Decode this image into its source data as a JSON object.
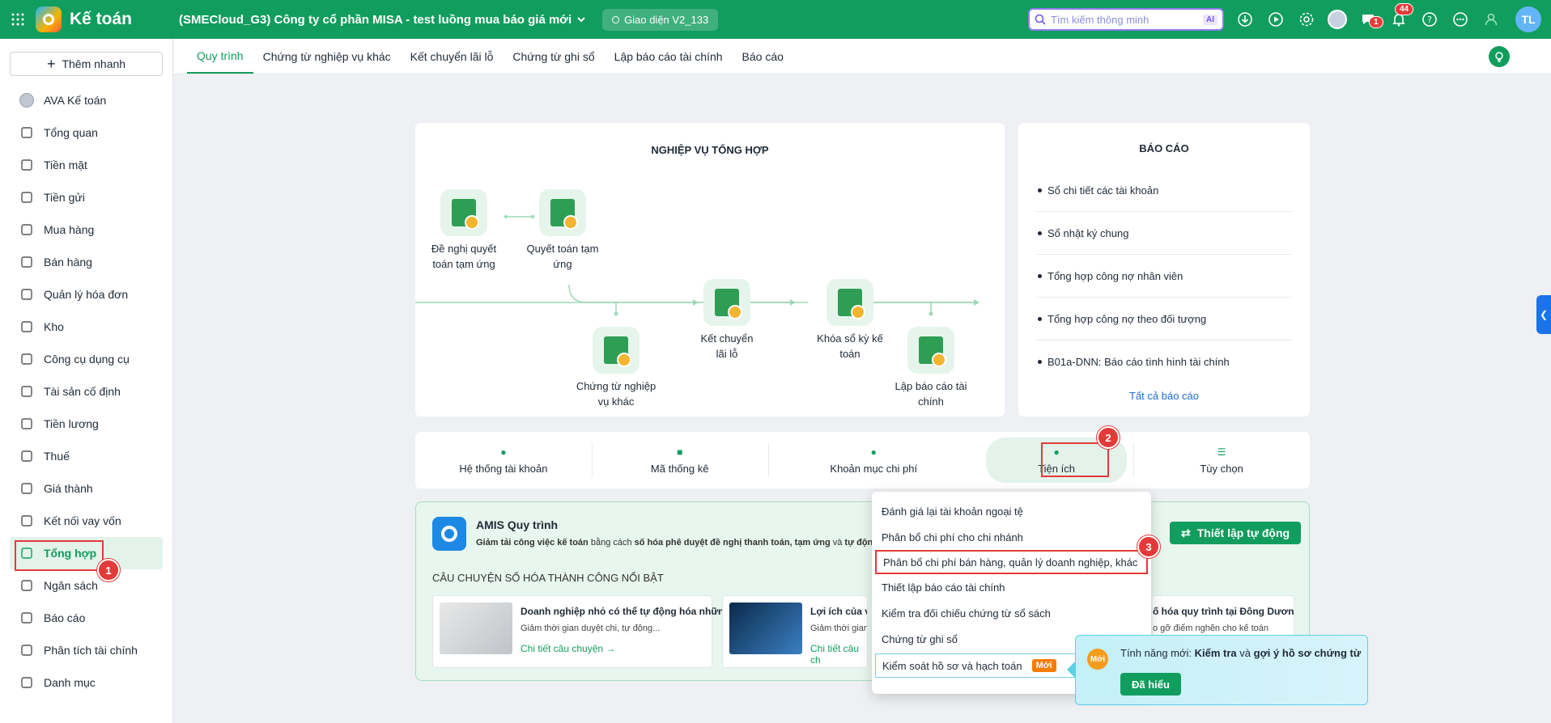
{
  "topbar": {
    "app_title": "Kế toán",
    "company": "(SMECloud_G3) Công ty cổ phần MISA - test luồng mua báo giá mới",
    "version": "Giao diện V2_133",
    "search_placeholder": "Tìm kiếm thông minh",
    "ai_label": "AI",
    "chat_badge": "1",
    "notif_badge": "44",
    "user_initials": "TL"
  },
  "sidebar": {
    "quick_add": "Thêm nhanh",
    "items": [
      {
        "label": "AVA Kế toán",
        "icon": "ava-avatar-icon"
      },
      {
        "label": "Tổng quan",
        "icon": "dashboard-icon"
      },
      {
        "label": "Tiền mặt",
        "icon": "cash-icon"
      },
      {
        "label": "Tiền gửi",
        "icon": "bank-icon"
      },
      {
        "label": "Mua hàng",
        "icon": "shopping-bag-icon"
      },
      {
        "label": "Bán hàng",
        "icon": "cart-icon"
      },
      {
        "label": "Quản lý hóa đơn",
        "icon": "invoice-icon"
      },
      {
        "label": "Kho",
        "icon": "warehouse-icon"
      },
      {
        "label": "Công cụ dụng cụ",
        "icon": "tools-icon"
      },
      {
        "label": "Tài sản cố định",
        "icon": "truck-icon"
      },
      {
        "label": "Tiền lương",
        "icon": "salary-icon"
      },
      {
        "label": "Thuế",
        "icon": "tax-icon"
      },
      {
        "label": "Giá thành",
        "icon": "price-tag-icon"
      },
      {
        "label": "Kết nối vay vốn",
        "icon": "loan-icon"
      },
      {
        "label": "Tổng hợp",
        "icon": "summary-icon"
      },
      {
        "label": "Ngân sách",
        "icon": "budget-icon"
      },
      {
        "label": "Báo cáo",
        "icon": "report-icon"
      },
      {
        "label": "Phân tích tài chính",
        "icon": "analysis-icon"
      },
      {
        "label": "Danh mục",
        "icon": "list-icon"
      }
    ]
  },
  "subtabs": [
    "Quy trình",
    "Chứng từ nghiệp vụ khác",
    "Kết chuyển lãi lỗ",
    "Chứng từ ghi sổ",
    "Lập báo cáo tài chính",
    "Báo cáo"
  ],
  "flow": {
    "title": "NGHIỆP VỤ TỔNG HỢP",
    "nodes": {
      "n1": "Đề nghị quyết toán tạm ứng",
      "n2": "Quyết toán tạm ứng",
      "n3": "Chứng từ nghiệp vụ khác",
      "n4": "Kết chuyển lãi lỗ",
      "n5": "Khóa sổ kỳ kế toán",
      "n6": "Lập báo cáo tài chính"
    }
  },
  "reports": {
    "title": "BÁO CÁO",
    "items": [
      "Sổ chi tiết các tài khoản",
      "Sổ nhật ký chung",
      "Tổng hợp công nợ nhân viên",
      "Tổng hợp công nợ theo đối tượng",
      "B01a-DNN: Báo cáo tình hình tài chính"
    ],
    "all_link": "Tất cả báo cáo"
  },
  "utils": [
    "Hệ thống tài khoản",
    "Mã thống kê",
    "Khoản mục chi phí",
    "Tiện ích",
    "Tùy chọn"
  ],
  "amis": {
    "title": "AMIS Quy trình",
    "sub_a": "Giảm tải công việc kế toán",
    "sub_b": " bằng cách ",
    "sub_c": "số hóa phê duyệt đề nghị thanh toán, tạm ứng",
    "sub_d": " và ",
    "sub_e": "tự động",
    "auto_button": "Thiết lập tự động",
    "stories_title": "CÂU CHUYỆN SỐ HÓA THÀNH CÔNG NỔI BẬT",
    "stories": [
      {
        "title": "Doanh nghiệp nhỏ có thể tự động hóa những...",
        "desc": "Giảm thời gian duyệt chi, tự động...",
        "link": "Chi tiết câu chuyện"
      },
      {
        "title": "Lợi ích của việc",
        "desc": "Giảm thời gian",
        "link": "Chi tiết câu ch"
      },
      {
        "title": "ố hóa quy trình tại Đông Dươn...",
        "desc": "o gỡ điểm nghẽn cho kế toán",
        "link": ""
      }
    ]
  },
  "dropdown": {
    "items": [
      "Đánh giá lại tài khoản ngoại tệ",
      "Phân bổ chi phí cho chi nhánh",
      "Phân bổ chi phí bán hàng, quản lý doanh nghiệp, khác",
      "Thiết lập báo cáo tài chính",
      "Kiểm tra đối chiếu chứng từ sổ sách",
      "Chứng từ ghi sổ",
      "Kiểm soát hồ sơ và hạch toán"
    ],
    "new_tag": "Mới"
  },
  "tooltip": {
    "circle": "Mới",
    "prefix": "Tính năng mới: ",
    "bold1": "Kiểm tra",
    "mid": " và ",
    "bold2": "gợi ý hồ sơ chứng từ",
    "button": "Đã hiểu"
  },
  "steps": [
    "1",
    "2",
    "3"
  ],
  "colors": {
    "brand": "#119d5e",
    "annotation": "#e33a3a",
    "link": "#1a6ed8"
  }
}
